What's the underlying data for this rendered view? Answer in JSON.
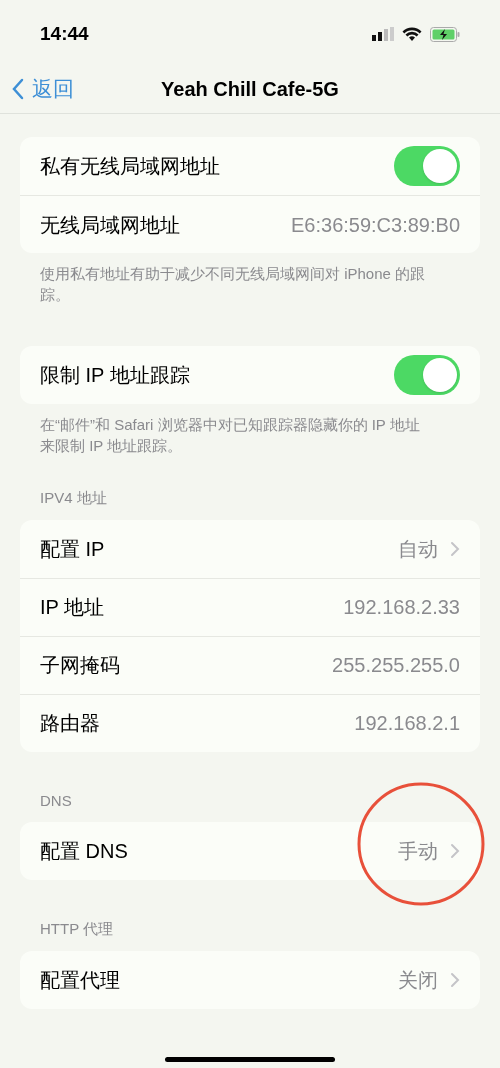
{
  "status_bar": {
    "time": "14:44"
  },
  "nav": {
    "back": "返回",
    "title": "Yeah Chill Cafe-5G"
  },
  "sections": [
    {
      "rows": [
        {
          "kind": "toggle",
          "label": "私有无线局域网地址",
          "on": true
        },
        {
          "kind": "value",
          "label": "无线局域网地址",
          "value": "E6:36:59:C3:89:B0"
        }
      ],
      "footer": "使用私有地址有助于减少不同无线局域网间对 iPhone 的跟踪。"
    },
    {
      "rows": [
        {
          "kind": "toggle",
          "label": "限制 IP 地址跟踪",
          "on": true
        }
      ],
      "footer": "在“邮件”和 Safari 浏览器中对已知跟踪器隐藏你的 IP 地址来限制 IP 地址跟踪。"
    },
    {
      "header": "IPV4 地址",
      "rows": [
        {
          "kind": "nav",
          "label": "配置 IP",
          "value": "自动"
        },
        {
          "kind": "value",
          "label": "IP 地址",
          "value": "192.168.2.33"
        },
        {
          "kind": "value",
          "label": "子网掩码",
          "value": "255.255.255.0"
        },
        {
          "kind": "value",
          "label": "路由器",
          "value": "192.168.2.1"
        }
      ]
    },
    {
      "header": "DNS",
      "rows": [
        {
          "kind": "nav",
          "label": "配置 DNS",
          "value": "手动",
          "circled": true
        }
      ]
    },
    {
      "header": "HTTP 代理",
      "rows": [
        {
          "kind": "nav",
          "label": "配置代理",
          "value": "关闭"
        }
      ]
    }
  ]
}
